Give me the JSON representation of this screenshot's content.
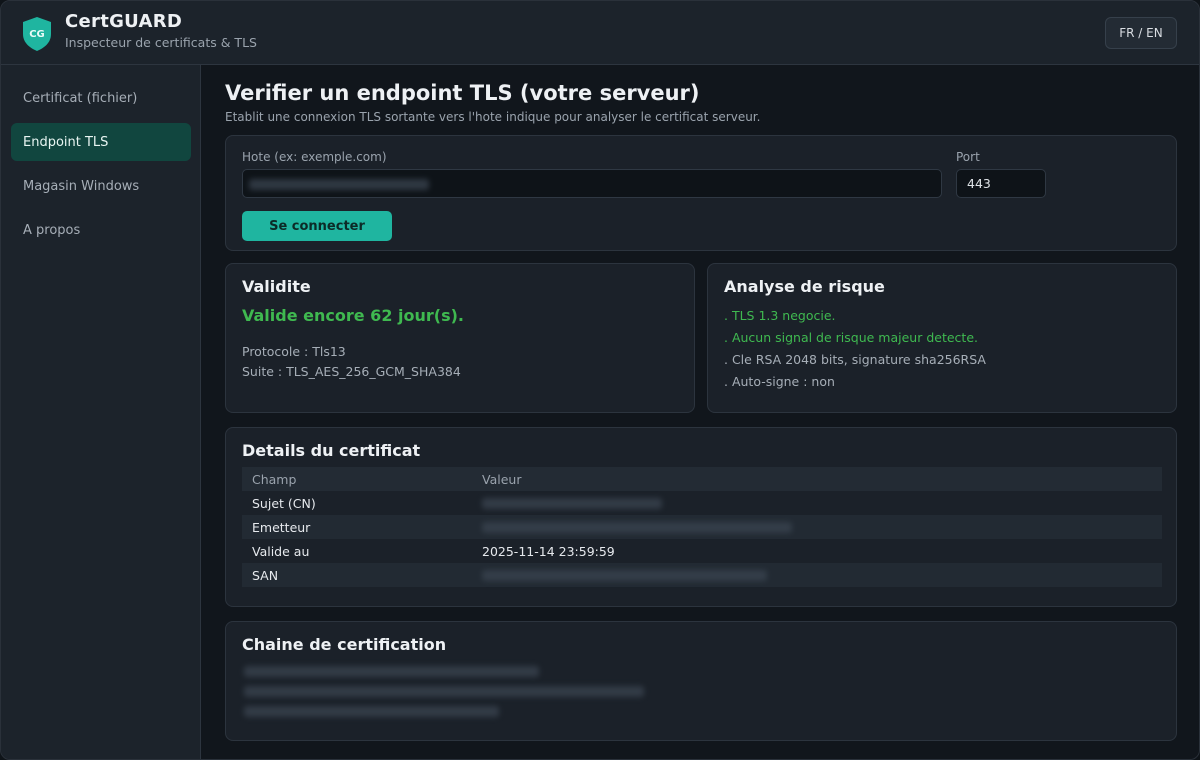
{
  "app": {
    "title": "CertGUARD",
    "subtitle": "Inspecteur de certificats & TLS",
    "logo_text": "CG",
    "lang_toggle": "FR / EN"
  },
  "colors": {
    "accent": "#1fb5a0",
    "success": "#3fb950",
    "active_nav": "#11463f"
  },
  "sidebar": {
    "items": [
      {
        "label": "Certificat (fichier)",
        "active": false
      },
      {
        "label": "Endpoint TLS",
        "active": true
      },
      {
        "label": "Magasin Windows",
        "active": false
      },
      {
        "label": "A propos",
        "active": false
      }
    ]
  },
  "main": {
    "title": "Verifier un endpoint TLS (votre serveur)",
    "description": "Etablit une connexion TLS sortante vers l'hote indique pour analyser le certificat serveur.",
    "form": {
      "host_label": "Hote (ex: exemple.com)",
      "port_label": "Port",
      "port_value": "443",
      "connect_label": "Se connecter"
    },
    "validity": {
      "title": "Validite",
      "status": "Valide encore 62 jour(s).",
      "protocol": "Protocole : Tls13",
      "suite": "Suite : TLS_AES_256_GCM_SHA384"
    },
    "risk": {
      "title": "Analyse de risque",
      "lines": [
        ". TLS 1.3 negocie.",
        ". Aucun signal de risque majeur detecte.",
        ". Cle RSA 2048 bits, signature sha256RSA",
        ". Auto-signe : non"
      ]
    },
    "details": {
      "title": "Details du certificat",
      "columns": [
        "Champ",
        "Valeur"
      ],
      "rows": [
        {
          "field": "Sujet (CN)",
          "value": ""
        },
        {
          "field": "Emetteur",
          "value": ""
        },
        {
          "field": "Valide au",
          "value": "2025-11-14 23:59:59"
        },
        {
          "field": "SAN",
          "value": ""
        }
      ]
    },
    "chain": {
      "title": "Chaine de certification"
    }
  }
}
